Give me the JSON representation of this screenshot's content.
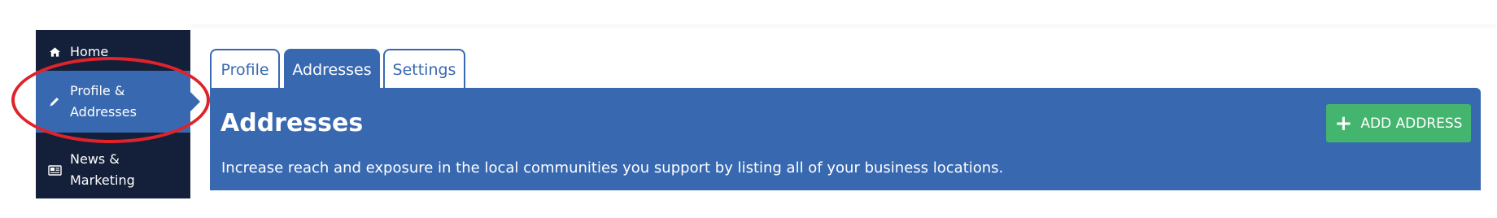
{
  "sidebar": {
    "items": [
      {
        "label": "Home",
        "icon": "home-icon"
      },
      {
        "label": "Profile & Addresses",
        "icon": "pencil-icon",
        "active": true
      },
      {
        "label": "News & Marketing",
        "icon": "newspaper-icon"
      }
    ]
  },
  "tabs": [
    {
      "label": "Profile"
    },
    {
      "label": "Addresses",
      "active": true
    },
    {
      "label": "Settings"
    }
  ],
  "panel": {
    "title": "Addresses",
    "description": "Increase reach and exposure in the local communities you support by listing all of your business locations.",
    "add_button_label": "ADD ADDRESS"
  },
  "colors": {
    "sidebar_bg": "#14203a",
    "accent_blue": "#3869b0",
    "button_green": "#44b56e",
    "highlight_red": "#e0232a"
  }
}
